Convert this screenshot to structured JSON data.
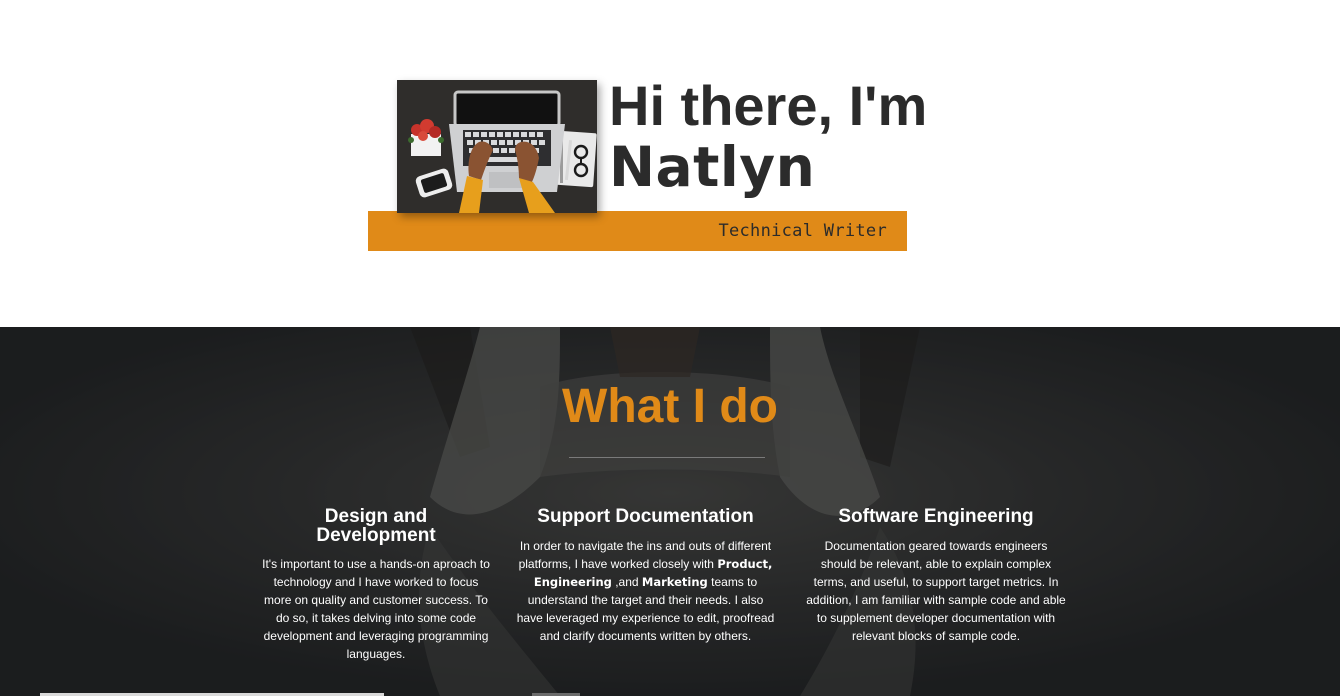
{
  "header": {
    "menu_icon": "hamburger-menu-icon",
    "accent_color": "#e08a18"
  },
  "hero": {
    "photo_icon": "laptop-workspace-photo",
    "greeting": "Hi there, I'm",
    "name": "Natlyn",
    "role": "Technical Writer"
  },
  "services": {
    "title": "What I do",
    "cards": [
      {
        "title": "Design and Development",
        "description": "It's important to use a hands-on aproach to technology and I have worked to focus more on quality and customer success. To do so, it takes delving into some code development and leveraging programming languages."
      },
      {
        "title": "Support Documentation",
        "desc_before": "In order to navigate the ins and outs of different platforms, I have worked closely with ",
        "highlight_1": "Product, Engineering",
        "desc_mid": " ,and ",
        "highlight_2": "Marketing",
        "desc_after": " teams to understand the target and their needs. I also have leveraged my experience to edit, proofread and clarify documents written by others."
      },
      {
        "title": "Software Engineering",
        "description": "Documentation geared towards engineers should be relevant, able to explain complex terms, and useful, to support target metrics. In addition, I am familiar with sample code and able to supplement developer documentation with relevant blocks of sample code."
      }
    ]
  }
}
